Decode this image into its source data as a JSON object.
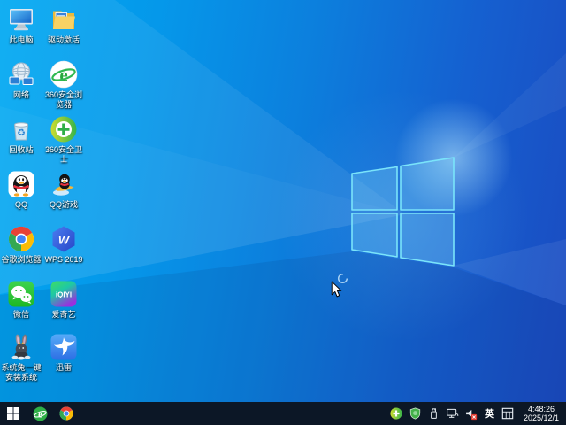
{
  "desktop": {
    "icons": [
      {
        "name": "this-pc",
        "label": "此电脑"
      },
      {
        "name": "driver-activation",
        "label": "驱动激活"
      },
      {
        "name": "network",
        "label": "网络"
      },
      {
        "name": "360-secure-browser",
        "label": "360安全浏览器",
        "icon_text": "e"
      },
      {
        "name": "recycle-bin",
        "label": "回收站",
        "icon_text": "♻"
      },
      {
        "name": "360-safety-guard",
        "label": "360安全卫士"
      },
      {
        "name": "qq",
        "label": "QQ"
      },
      {
        "name": "qq-games",
        "label": "QQ游戏"
      },
      {
        "name": "google-chrome",
        "label": "谷歌浏览器"
      },
      {
        "name": "wps-2019",
        "label": "WPS 2019",
        "icon_text": "W"
      },
      {
        "name": "wechat",
        "label": "微信"
      },
      {
        "name": "iqiyi",
        "label": "爱奇艺",
        "icon_text": "iQIYI"
      },
      {
        "name": "system-rabbit-installer",
        "label": "系统兔一键安装系统"
      },
      {
        "name": "xunlei",
        "label": "迅雷"
      }
    ]
  },
  "taskbar": {
    "tray": {
      "language_indicator": "英",
      "time": "4:48:26",
      "date": "2025/12/1"
    }
  },
  "colors": {
    "wallpaper_left": "#00a9f2",
    "wallpaper_right": "#1b4ac0",
    "taskbar": "#0c1726",
    "logo_stroke": "#7ae4fa"
  }
}
